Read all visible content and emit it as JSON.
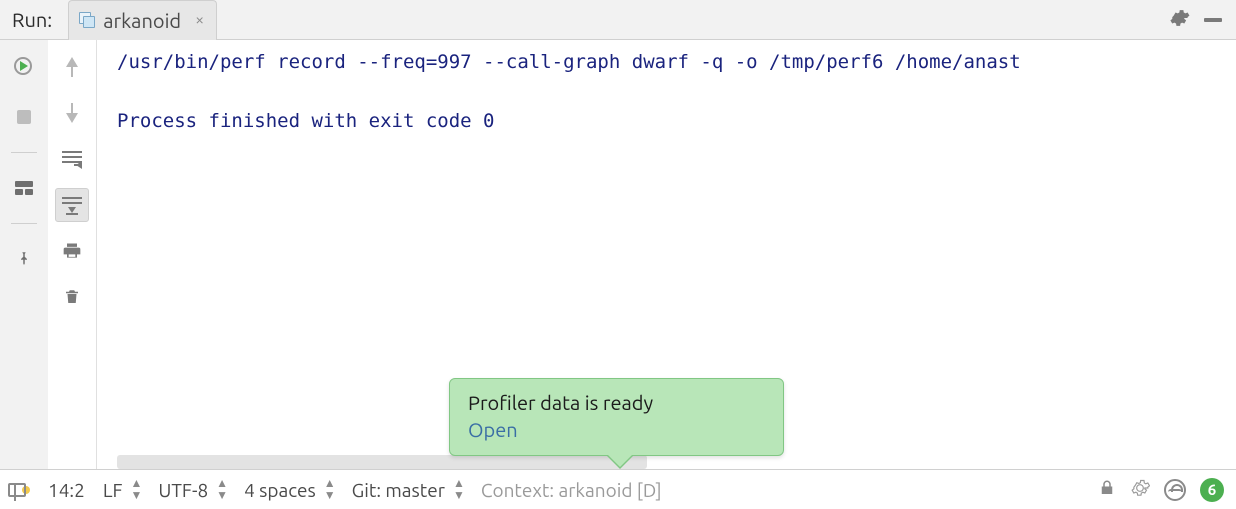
{
  "header": {
    "label": "Run:",
    "tab": {
      "name": "arkanoid"
    }
  },
  "console": {
    "line1": "/usr/bin/perf record --freq=997 --call-graph dwarf -q -o /tmp/perf6 /home/anast",
    "line2": "",
    "line3": "Process finished with exit code 0"
  },
  "notification": {
    "title": "Profiler data is ready",
    "action": "Open"
  },
  "statusbar": {
    "position": "14:2",
    "line_ending": "LF",
    "encoding": "UTF-8",
    "indent": "4 spaces",
    "vcs": "Git: master",
    "context": "Context: arkanoid [D]",
    "badge": "6"
  },
  "icons": {
    "gear": "gear-icon",
    "minimize": "minimize-icon",
    "rerun": "rerun-icon",
    "stop": "stop-icon",
    "layout": "layout-icon",
    "pin": "pin-icon",
    "up": "up-arrow-icon",
    "down": "down-arrow-icon",
    "softwrap": "softwrap-icon",
    "scrollend": "scroll-to-end-icon",
    "print": "print-icon",
    "trash": "trash-icon",
    "toolwindow": "tool-window-icon",
    "lock": "lock-icon",
    "ideupdate": "ide-update-icon",
    "inspector": "inspector-icon"
  }
}
